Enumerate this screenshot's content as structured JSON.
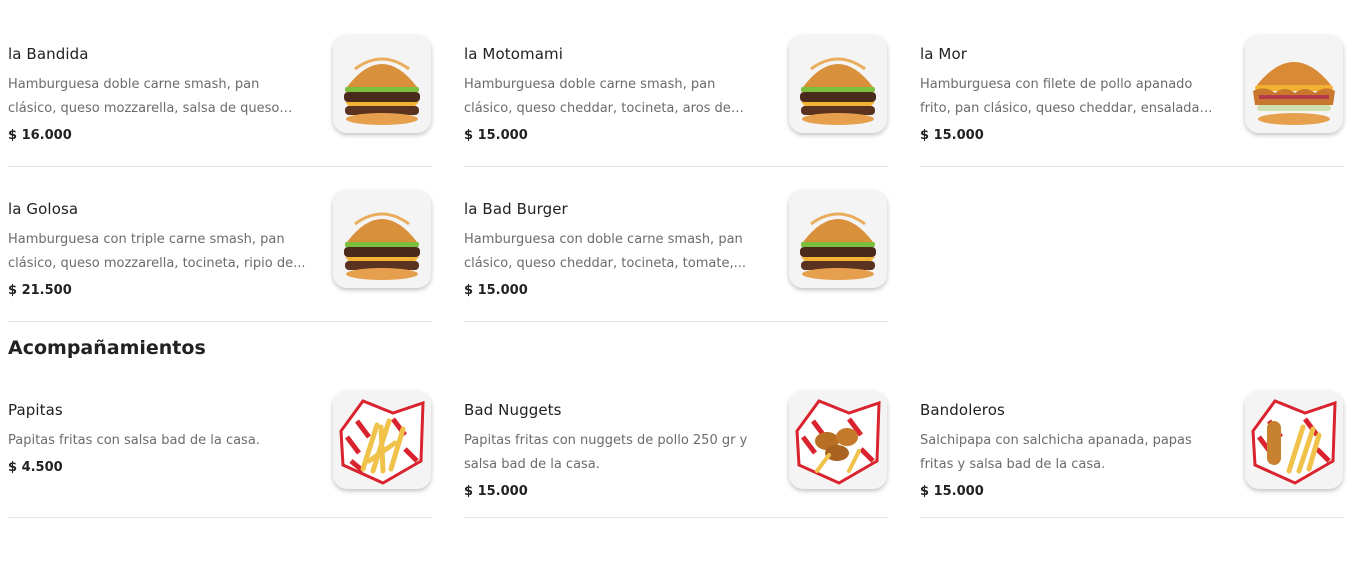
{
  "burgers": [
    {
      "name": "la Bandida",
      "description": "Hamburguesa doble carne smash, pan clásico, queso mozzarella, salsa de queso cheddar,...",
      "price": "$ 16.000",
      "image_icon": "burger-photo"
    },
    {
      "name": "la Motomami",
      "description": "Hamburguesa doble carne smash, pan clásico, queso cheddar, tocineta, aros de cebolla,...",
      "price": "$ 15.000",
      "image_icon": "burger-photo"
    },
    {
      "name": "la Mor",
      "description": "Hamburguesa con filete de pollo apanado frito, pan clásico, queso cheddar, ensalada dulce y...",
      "price": "$ 15.000",
      "image_icon": "chicken-burger-photo"
    },
    {
      "name": "la Golosa",
      "description": "Hamburguesa con triple carne smash, pan clásico, queso mozzarella, tocineta, ripio de...",
      "price": "$ 21.500",
      "image_icon": "burger-photo"
    },
    {
      "name": "la Bad Burger",
      "description": "Hamburguesa con doble carne smash, pan clásico, queso cheddar, tocineta, tomate,...",
      "price": "$ 15.000",
      "image_icon": "burger-photo"
    }
  ],
  "sides_section": {
    "title": "Acompañamientos",
    "items": [
      {
        "name": "Papitas",
        "description": "Papitas fritas con salsa bad de la casa.",
        "price": "$ 4.500",
        "image_icon": "fries-photo"
      },
      {
        "name": "Bad Nuggets",
        "description": "Papitas fritas con nuggets de pollo 250 gr y salsa bad de la casa.",
        "price": "$ 15.000",
        "image_icon": "nuggets-photo"
      },
      {
        "name": "Bandoleros",
        "description": "Salchipapa con salchicha apanada, papas fritas y salsa bad de la casa.",
        "price": "$ 15.000",
        "image_icon": "salchipapa-photo"
      }
    ]
  },
  "colors": {
    "bun": "#d9903a",
    "patty": "#4a2a1a",
    "cheese": "#f2b233",
    "lettuce": "#6fb83a",
    "paper_red": "#d9232e",
    "fries": "#f0c24a"
  }
}
